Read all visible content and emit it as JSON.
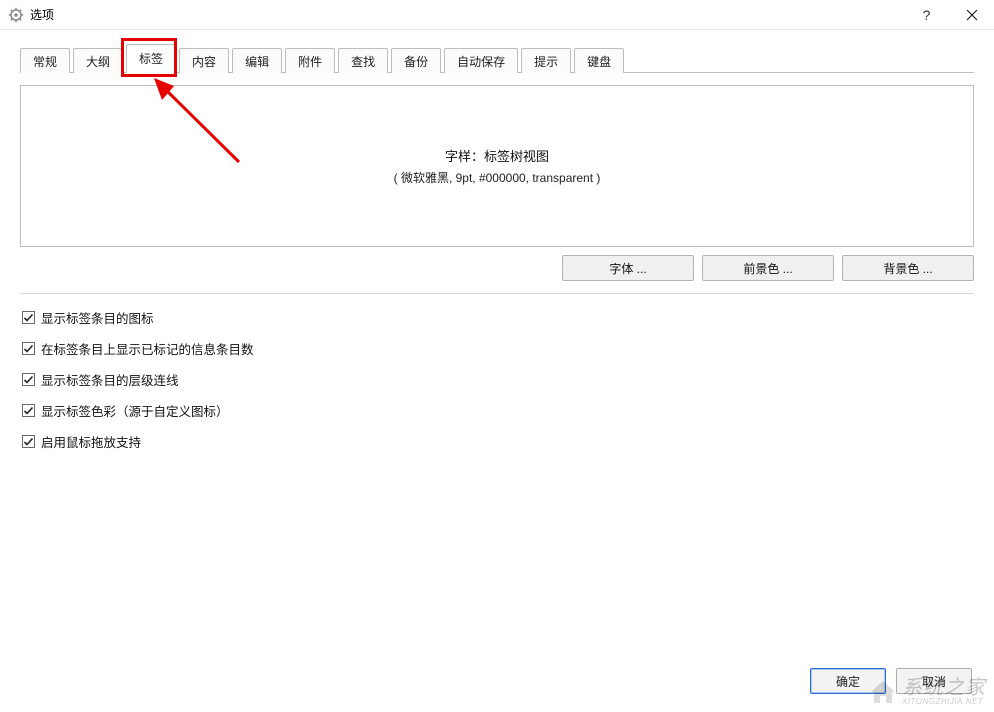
{
  "window": {
    "title": "选项",
    "help_symbol": "?",
    "close_symbol": "×"
  },
  "tabs": [
    {
      "label": "常规"
    },
    {
      "label": "大纲"
    },
    {
      "label": "标签",
      "active": true
    },
    {
      "label": "内容"
    },
    {
      "label": "编辑"
    },
    {
      "label": "附件"
    },
    {
      "label": "查找"
    },
    {
      "label": "备份"
    },
    {
      "label": "自动保存"
    },
    {
      "label": "提示"
    },
    {
      "label": "键盘"
    }
  ],
  "preview": {
    "line1": "字样：标签树视图",
    "line2": "( 微软雅黑, 9pt, #000000, transparent )"
  },
  "style_buttons": {
    "font": "字体 ...",
    "fg": "前景色 ...",
    "bg": "背景色 ..."
  },
  "checks": [
    {
      "label": "显示标签条目的图标",
      "checked": true
    },
    {
      "label": "在标签条目上显示已标记的信息条目数",
      "checked": true
    },
    {
      "label": "显示标签条目的层级连线",
      "checked": true
    },
    {
      "label": "显示标签色彩（源于自定义图标）",
      "checked": true
    },
    {
      "label": "启用鼠标拖放支持",
      "checked": true
    }
  ],
  "dialog_buttons": {
    "ok": "确定",
    "cancel": "取消"
  },
  "watermark": {
    "text": "系统之家",
    "sub": "XITONGZHIJIA.NET"
  }
}
